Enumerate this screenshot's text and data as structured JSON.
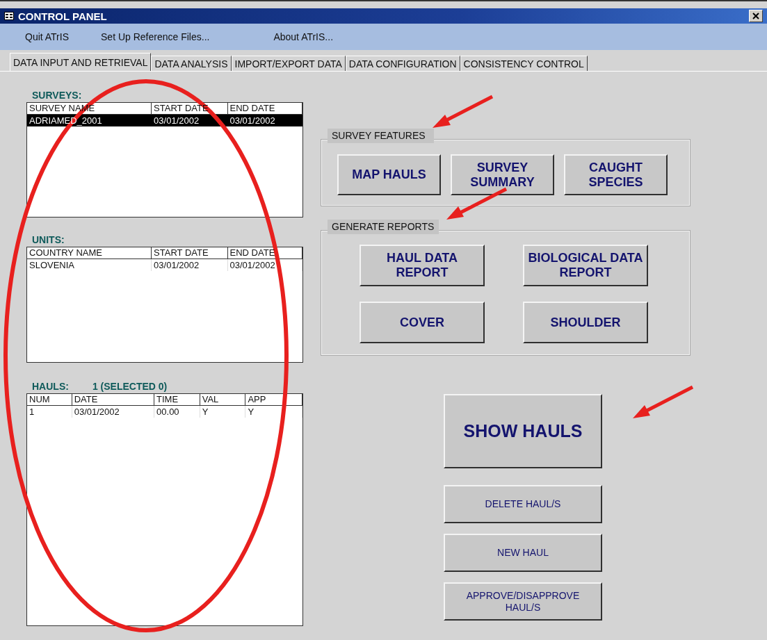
{
  "window": {
    "title": "CONTROL PANEL"
  },
  "menu": [
    "Quit ATrIS",
    "Set Up Reference Files...",
    "About ATrIS..."
  ],
  "tabs": [
    {
      "label": "DATA INPUT AND RETRIEVAL",
      "selected": true
    },
    {
      "label": "DATA ANALYSIS",
      "selected": false
    },
    {
      "label": "IMPORT/EXPORT DATA",
      "selected": false
    },
    {
      "label": "DATA CONFIGURATION",
      "selected": false
    },
    {
      "label": "CONSISTENCY CONTROL",
      "selected": false
    }
  ],
  "lists": [
    {
      "title": "SURVEYS:",
      "columns": [
        "SURVEY NAME",
        "START DATE",
        "END DATE"
      ],
      "rows": [
        {
          "cells": [
            "ADRIAMED_2001",
            "03/01/2002",
            "03/01/2002"
          ],
          "selected": true
        }
      ]
    },
    {
      "title": "UNITS:",
      "columns": [
        "COUNTRY NAME",
        "START DATE",
        "END DATE"
      ],
      "rows": [
        {
          "cells": [
            "SLOVENIA",
            "03/01/2002",
            "03/01/2002"
          ],
          "selected": false
        }
      ]
    },
    {
      "title": "HAULS:",
      "count": "1 (SELECTED 0)",
      "columns": [
        "NUM",
        "DATE",
        "TIME",
        "VAL",
        "APP"
      ],
      "rows": [
        {
          "cells": [
            "1",
            "03/01/2002",
            "00.00",
            "Y",
            "Y"
          ],
          "selected": false
        }
      ]
    }
  ],
  "survey_features": {
    "title": "SURVEY FEATURES",
    "buttons": [
      "MAP HAULS",
      "SURVEY SUMMARY",
      "CAUGHT SPECIES"
    ]
  },
  "generate_reports": {
    "title": "GENERATE REPORTS",
    "buttons": [
      "HAUL DATA REPORT",
      "BIOLOGICAL DATA REPORT",
      "COVER",
      "SHOULDER"
    ]
  },
  "haul_buttons": [
    {
      "label": "SHOW HAULS",
      "kind": "large"
    },
    {
      "label": "DELETE HAUL/S",
      "kind": "small"
    },
    {
      "label": "NEW HAUL",
      "kind": "small"
    },
    {
      "label": "APPROVE/DISAPPROVE HAUL/S",
      "kind": "small"
    }
  ]
}
